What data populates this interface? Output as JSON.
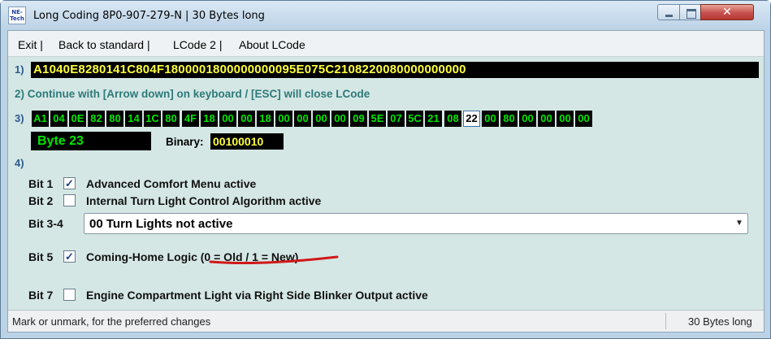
{
  "window": {
    "app_icon_text": "NE-Tech",
    "title": "Long Coding  8P0-907-279-N | 30 Bytes long",
    "close_glyph": "✕"
  },
  "menu": [
    {
      "label": "Exit |"
    },
    {
      "label": "Back to standard |"
    },
    {
      "label": "LCode 2 |"
    },
    {
      "label": "About LCode"
    }
  ],
  "section_labels": {
    "s1": "1)",
    "s3": "3)",
    "s4": "4)"
  },
  "full_code": "A1040E8280141C804F1800001800000000095E075C2108220080000000000",
  "instruction": "2) Continue with [Arrow down] on keyboard / [ESC] will close LCode",
  "bytes": [
    "A1",
    "04",
    "0E",
    "82",
    "80",
    "14",
    "1C",
    "80",
    "4F",
    "18",
    "00",
    "00",
    "18",
    "00",
    "00",
    "00",
    "00",
    "09",
    "5E",
    "07",
    "5C",
    "21",
    "08",
    "22",
    "00",
    "80",
    "00",
    "00",
    "00",
    "00"
  ],
  "selected_byte_index": 23,
  "byte_label": "Byte 23",
  "binary_label": "Binary:",
  "binary_value": "00100010",
  "bits": [
    {
      "name": "Bit 1",
      "checked": true,
      "check_glyph": "✓",
      "desc": "Advanced Comfort Menu active"
    },
    {
      "name": "Bit 2",
      "checked": false,
      "check_glyph": "",
      "desc": "Internal Turn Light Control Algorithm active"
    },
    {
      "name": "Bit 3-4",
      "dropdown_value": "00 Turn Lights not active",
      "arrow_glyph": "▼"
    },
    {
      "name": "Bit 5",
      "checked": true,
      "check_glyph": "✓",
      "desc": "Coming-Home Logic (0 = Old / 1 = New)"
    },
    {
      "name": "Bit 7",
      "checked": false,
      "check_glyph": "",
      "desc": "Engine Compartment Light via Right Side Blinker Output active"
    }
  ],
  "status": {
    "left": "Mark or unmark, for the preferred changes",
    "right": "30 Bytes long"
  },
  "colors": {
    "code_text": "#ffff40",
    "byte_text": "#00e600",
    "instruction": "#2d7a78",
    "annotation": "#d01818"
  }
}
